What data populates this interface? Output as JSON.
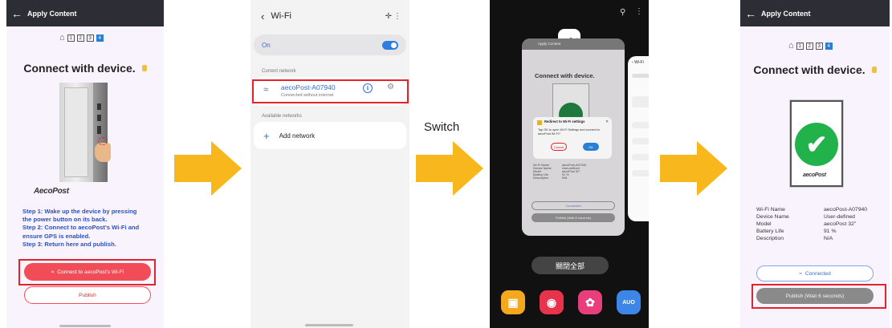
{
  "panel1": {
    "title": "Apply Content",
    "steps": [
      "1",
      "2",
      "3",
      "4"
    ],
    "heading": "Connect with device.",
    "brand": "AecoPost",
    "instructions": [
      "Step 1: Wake up the device by pressing",
      "the power button on its back.",
      "Step 2: Connect to aecoPost's Wi-Fi and",
      "ensure GPS is enabled.",
      "Step 3: Return here and publish."
    ],
    "connect_button": "Connect to aecoPost's Wi-Fi",
    "publish_button": "Publish"
  },
  "panel2": {
    "title": "Wi-Fi",
    "on_label": "On",
    "current_network_header": "Current network",
    "network_name": "aecoPost-A07940",
    "network_status": "Connected without internet",
    "available_header": "Available networks",
    "add_network": "Add network"
  },
  "switch_label": "Switch",
  "panel3": {
    "mini_title": "Apply Content",
    "mini_heading": "Connect with device.",
    "brand": "aecoPost",
    "dialog_title": "Redirect to Wi-Fi settings",
    "dialog_body": "Tap OK to open Wi-Fi Settings and connect to aecoPost Wi-Fi?",
    "dialog_cancel": "Cancel",
    "dialog_ok": "OK",
    "mini_info": [
      [
        "Wi-Fi Name",
        "aecoPost-A07940"
      ],
      [
        "Device Name",
        "User-defined"
      ],
      [
        "Model",
        "aecoPost 32\""
      ],
      [
        "Battery Life",
        "91 %"
      ],
      [
        "Description",
        "N/A"
      ]
    ],
    "mini_connected": "Connected",
    "mini_publish": "Publish (Wait 6 seconds)",
    "side_title": "Wi-Fi",
    "close_all": "關閉全部",
    "auo_label": "AUO"
  },
  "panel4": {
    "title": "Apply Content",
    "steps": [
      "1",
      "2",
      "3",
      "4"
    ],
    "heading": "Connect with device.",
    "brand": "aecoPost",
    "info": [
      [
        "Wi-Fi Name",
        "aecoPost-A07940"
      ],
      [
        "Device Name",
        "User-defined"
      ],
      [
        "Model",
        "aecoPost 32\""
      ],
      [
        "Battery Life",
        "91 %"
      ],
      [
        "Description",
        "N/A"
      ]
    ],
    "connected_button": "Connected",
    "publish_button": "Publish (Wait 6 seconds)"
  },
  "colors": {
    "appbar": "#2d2d35",
    "accent_red": "#f24c58",
    "highlight_box": "#e3232b",
    "arrow": "#f7b71d",
    "instruction_blue": "#2a52be",
    "check_green": "#22b24c"
  }
}
